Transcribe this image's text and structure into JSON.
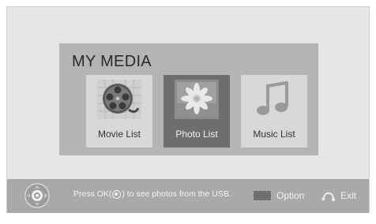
{
  "panel": {
    "title": "MY MEDIA"
  },
  "tiles": [
    {
      "label": "Movie List",
      "icon": "film-reel-icon",
      "selected": false
    },
    {
      "label": "Photo List",
      "icon": "photo-icon",
      "selected": true
    },
    {
      "label": "Music List",
      "icon": "music-note-icon",
      "selected": false
    }
  ],
  "footer": {
    "hint_before": "Press OK(",
    "hint_after": ") to see photos from the USB.",
    "option_label": "Option",
    "exit_label": "Exit"
  },
  "colors": {
    "panel": "#b4b4b4",
    "tile": "#d8d8d8",
    "tile_selected": "#6e6e6e",
    "footer": "#a9a9a9",
    "option_key": "#707070"
  }
}
